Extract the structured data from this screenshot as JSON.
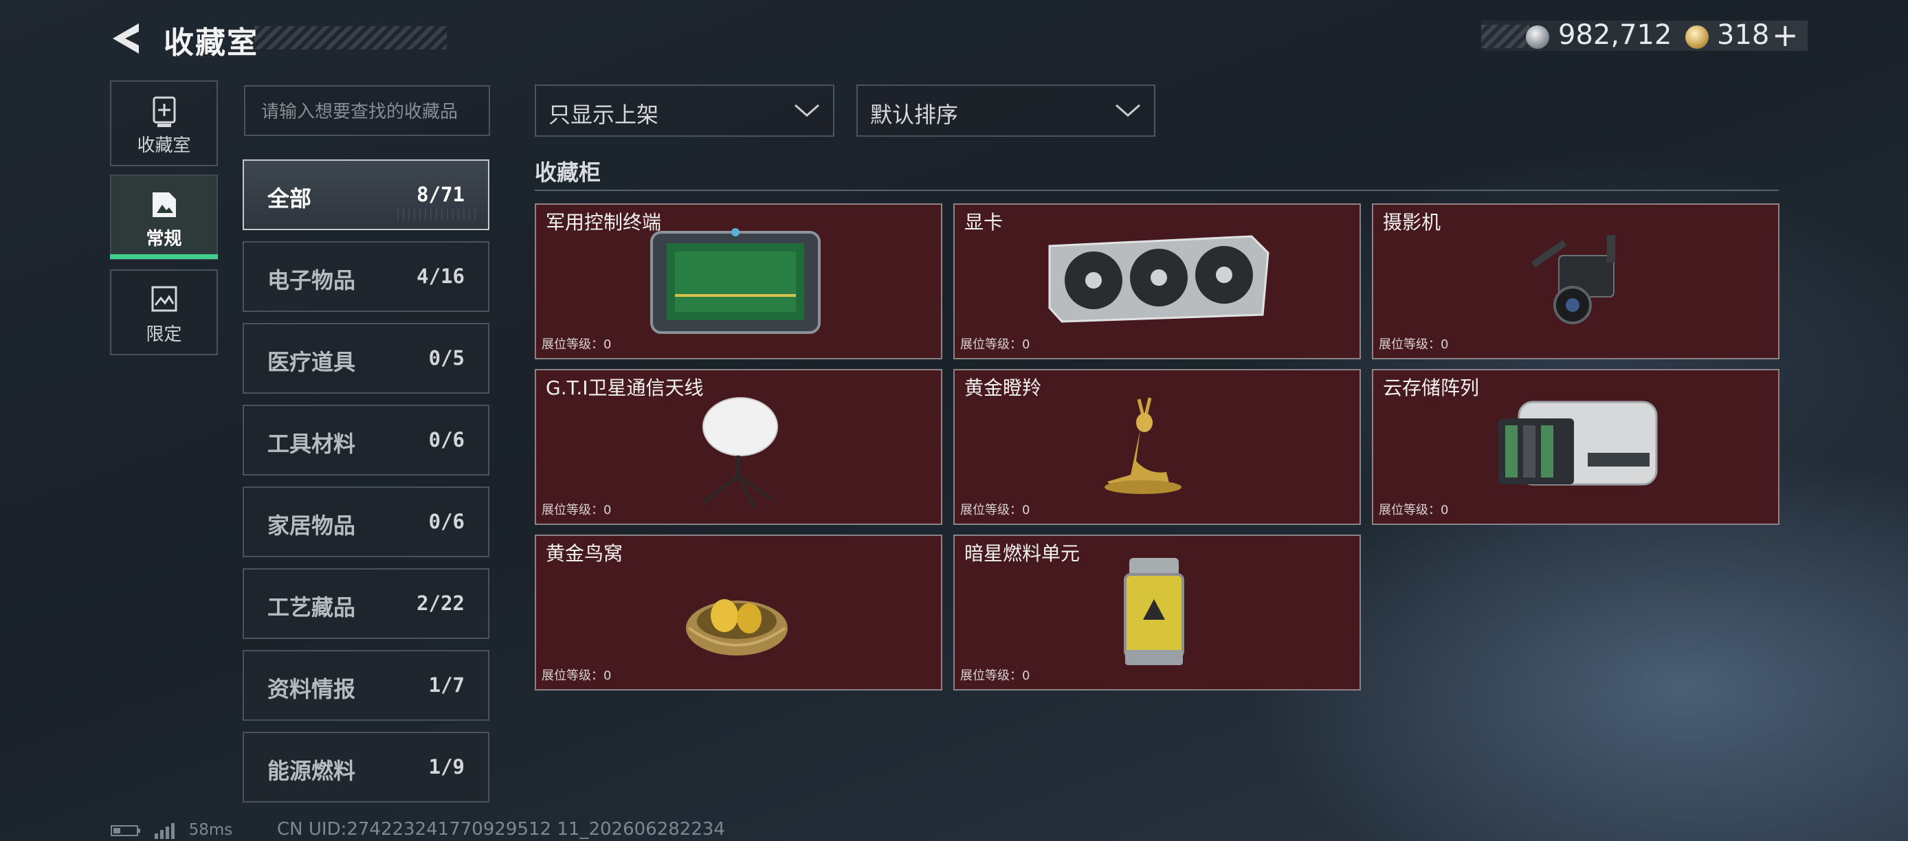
{
  "header": {
    "title": "收藏室",
    "currency": {
      "silver_value": "982,712",
      "gold_value": "318",
      "gold_plus": "+"
    }
  },
  "nav": [
    {
      "label": "收藏室",
      "icon": "cabinet-icon",
      "active": false
    },
    {
      "label": "常规",
      "icon": "picture-icon",
      "active": true
    },
    {
      "label": "限定",
      "icon": "landscape-icon",
      "active": false
    }
  ],
  "search": {
    "placeholder": "请输入想要查找的收藏品"
  },
  "categories": [
    {
      "name": "全部",
      "count": "8/71",
      "active": true
    },
    {
      "name": "电子物品",
      "count": "4/16"
    },
    {
      "name": "医疗道具",
      "count": "0/5"
    },
    {
      "name": "工具材料",
      "count": "0/6"
    },
    {
      "name": "家居物品",
      "count": "0/6"
    },
    {
      "name": "工艺藏品",
      "count": "2/22"
    },
    {
      "name": "资料情报",
      "count": "1/7"
    },
    {
      "name": "能源燃料",
      "count": "1/9"
    }
  ],
  "filters": {
    "filter_selected": "只显示上架",
    "sort_selected": "默认排序"
  },
  "section": {
    "title": "收藏柜"
  },
  "items": [
    {
      "name": "军用控制终端",
      "level_label": "展位等级：0",
      "icon": "tablet-icon"
    },
    {
      "name": "显卡",
      "level_label": "展位等级：0",
      "icon": "graphics-card-icon"
    },
    {
      "name": "摄影机",
      "level_label": "展位等级：0",
      "icon": "video-camera-icon"
    },
    {
      "name": "G.T.I卫星通信天线",
      "level_label": "展位等级：0",
      "icon": "satellite-dish-icon"
    },
    {
      "name": "黄金瞪羚",
      "level_label": "展位等级：0",
      "icon": "golden-gazelle-icon"
    },
    {
      "name": "云存储阵列",
      "level_label": "展位等级：0",
      "icon": "storage-array-icon"
    },
    {
      "name": "黄金鸟窝",
      "level_label": "展位等级：0",
      "icon": "golden-nest-icon"
    },
    {
      "name": "暗星燃料单元",
      "level_label": "展位等级：0",
      "icon": "fuel-canister-icon"
    }
  ],
  "footer": {
    "ping": "58ms",
    "uid": "CN UID:274223241770929512 11_202606282234"
  },
  "colors": {
    "accent_green": "#3fd08e",
    "card_bg": "#46191f",
    "card_border": "#8b8388"
  }
}
